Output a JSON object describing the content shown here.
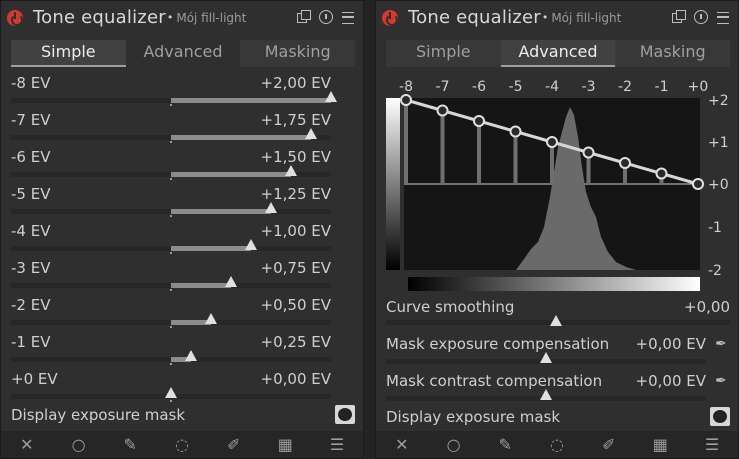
{
  "module": {
    "title": "Tone equalizer",
    "dot": "•",
    "preset": "Mój fill-light"
  },
  "tabs": [
    "Simple",
    "Advanced",
    "Masking"
  ],
  "left": {
    "selected_tab": "Simple",
    "sliders": [
      {
        "label": "-8 EV",
        "value": "+2,00 EV",
        "amount": 2.0
      },
      {
        "label": "-7 EV",
        "value": "+1,75 EV",
        "amount": 1.75
      },
      {
        "label": "-6 EV",
        "value": "+1,50 EV",
        "amount": 1.5
      },
      {
        "label": "-5 EV",
        "value": "+1,25 EV",
        "amount": 1.25
      },
      {
        "label": "-4 EV",
        "value": "+1,00 EV",
        "amount": 1.0
      },
      {
        "label": "-3 EV",
        "value": "+0,75 EV",
        "amount": 0.75
      },
      {
        "label": "-2 EV",
        "value": "+0,50 EV",
        "amount": 0.5
      },
      {
        "label": "-1 EV",
        "value": "+0,25 EV",
        "amount": 0.25
      },
      {
        "label": "+0 EV",
        "value": "+0,00 EV",
        "amount": 0.0
      }
    ],
    "slider_range": [
      -2,
      2
    ],
    "display_mask_label": "Display exposure mask"
  },
  "right": {
    "selected_tab": "Advanced",
    "graph": {
      "x_ticks": [
        "-8",
        "-7",
        "-6",
        "-5",
        "-4",
        "-3",
        "-2",
        "-1",
        "+0"
      ],
      "y_ticks": [
        "+2",
        "+1",
        "+0",
        "-1",
        "-2"
      ],
      "curve_values": [
        2.0,
        1.75,
        1.5,
        1.25,
        1.0,
        0.75,
        0.5,
        0.25,
        0.0
      ]
    },
    "curve_smoothing": {
      "label": "Curve smoothing",
      "value": "+0,00"
    },
    "mask_exposure": {
      "label": "Mask exposure compensation",
      "value": "+0,00 EV"
    },
    "mask_contrast": {
      "label": "Mask contrast compensation",
      "value": "+0,00 EV"
    },
    "display_mask_label": "Display exposure mask"
  },
  "footer_icons": [
    "close-icon",
    "circle-icon",
    "pencil-icon",
    "spinner-icon",
    "brush-icon",
    "checker-icon",
    "menu-icon"
  ],
  "colors": {
    "power": "#d23a2e",
    "background": "#2f2f2f"
  }
}
